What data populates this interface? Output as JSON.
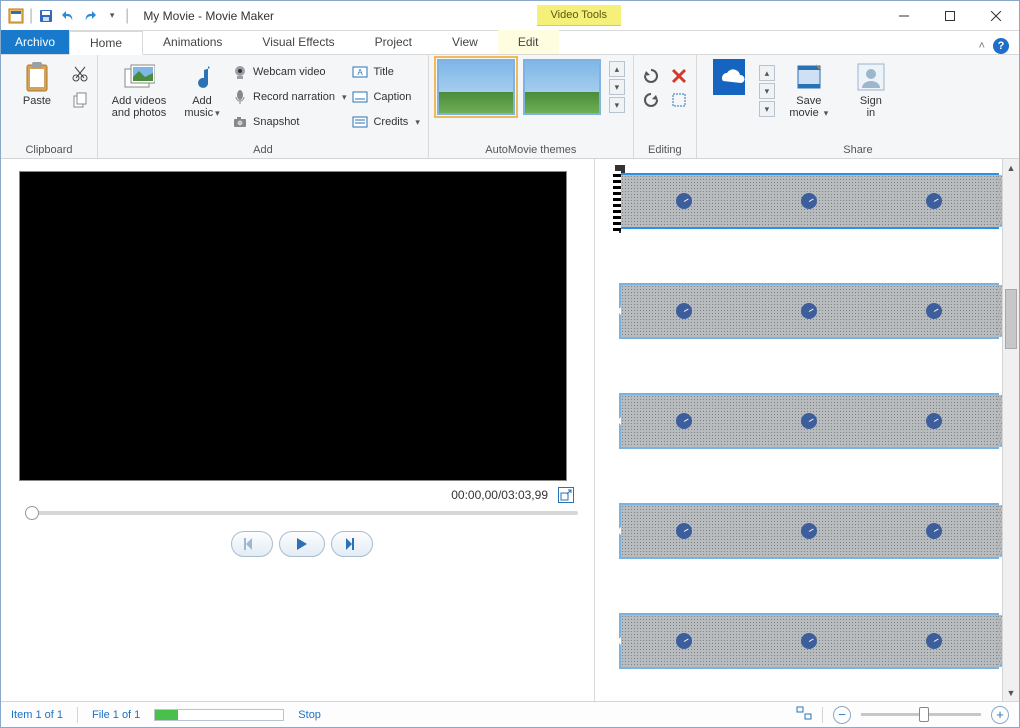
{
  "titlebar": {
    "title": "My Movie - Movie Maker",
    "contextual": "Video Tools"
  },
  "tabs": {
    "file": "Archivo",
    "items": [
      "Home",
      "Animations",
      "Visual Effects",
      "Project",
      "View",
      "Edit"
    ],
    "active_index": 0
  },
  "ribbon": {
    "clipboard": {
      "label": "Clipboard",
      "paste": "Paste"
    },
    "add": {
      "label": "Add",
      "add_videos": "Add videos\nand photos",
      "add_music": "Add\nmusic",
      "webcam": "Webcam video",
      "record": "Record narration",
      "snapshot": "Snapshot",
      "title": "Title",
      "caption": "Caption",
      "credits": "Credits"
    },
    "automovie": {
      "label": "AutoMovie themes"
    },
    "editing": {
      "label": "Editing"
    },
    "share": {
      "label": "Share",
      "save_movie": "Save\nmovie",
      "sign_in": "Sign\nin"
    }
  },
  "preview": {
    "timecode": "00:00,00/03:03,99"
  },
  "status": {
    "item": "Item 1 of 1",
    "file": "File 1 of 1",
    "stop": "Stop"
  }
}
